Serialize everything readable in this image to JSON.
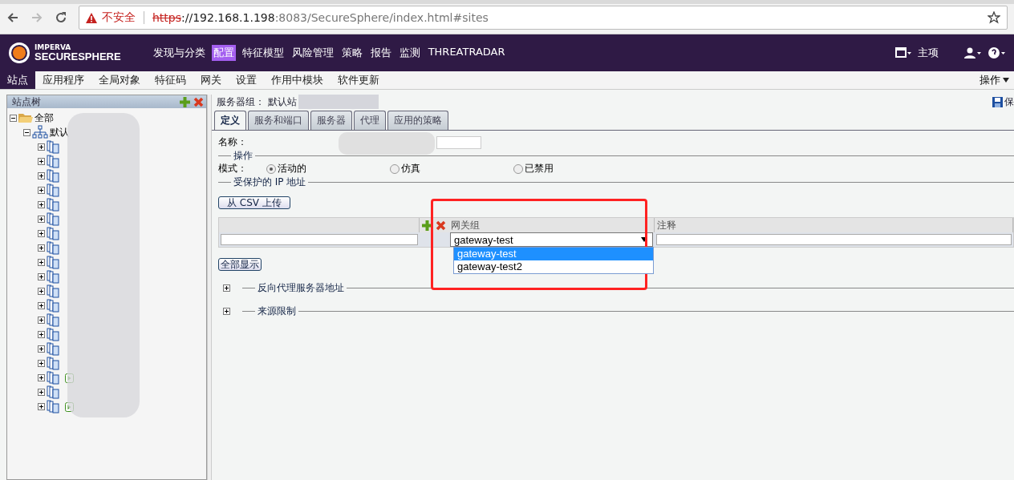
{
  "browser": {
    "security_label": "不安全",
    "url_scheme": "https",
    "url_host": "://192.168.1.198",
    "url_path": ":8083/SecureSphere/index.html#sites"
  },
  "header": {
    "brand_top": "IMPERVA",
    "brand_bottom": "SECURESPHERE",
    "nav": [
      {
        "label": "发现与分类",
        "selected": false
      },
      {
        "label": "配置",
        "selected": true
      },
      {
        "label": "特征模型",
        "selected": false
      },
      {
        "label": "风险管理",
        "selected": false
      },
      {
        "label": "策略",
        "selected": false
      },
      {
        "label": "报告",
        "selected": false
      },
      {
        "label": "监测",
        "selected": false
      },
      {
        "label": "THREATRADAR",
        "selected": false
      }
    ],
    "home_label": "主项"
  },
  "subnav": {
    "tabs": [
      {
        "label": "站点",
        "selected": true
      },
      {
        "label": "应用程序",
        "selected": false
      },
      {
        "label": "全局对象",
        "selected": false
      },
      {
        "label": "特征码",
        "selected": false
      },
      {
        "label": "网关",
        "selected": false
      },
      {
        "label": "设置",
        "selected": false
      },
      {
        "label": "作用中模块",
        "selected": false
      },
      {
        "label": "软件更新",
        "selected": false
      }
    ],
    "actions_label": "操作"
  },
  "sidebar": {
    "title": "站点树",
    "tree": [
      {
        "label": "全部",
        "expanded": true,
        "children": [
          {
            "label": "默认",
            "expanded": true,
            "children": [
              {
                "expanded": false,
                "running": false
              },
              {
                "expanded": false,
                "running": false
              },
              {
                "expanded": false,
                "running": false
              },
              {
                "expanded": false,
                "running": false
              },
              {
                "expanded": false,
                "running": false
              },
              {
                "expanded": false,
                "running": false
              },
              {
                "expanded": false,
                "running": false
              },
              {
                "expanded": false,
                "running": false
              },
              {
                "expanded": false,
                "running": false
              },
              {
                "expanded": false,
                "running": false
              },
              {
                "expanded": false,
                "running": false
              },
              {
                "expanded": false,
                "running": false
              },
              {
                "expanded": false,
                "running": false
              },
              {
                "expanded": false,
                "running": false
              },
              {
                "expanded": false,
                "running": false
              },
              {
                "expanded": false,
                "running": false
              },
              {
                "expanded": false,
                "running": true
              },
              {
                "expanded": false,
                "running": false
              },
              {
                "expanded": false,
                "running": true
              }
            ]
          }
        ]
      }
    ]
  },
  "content": {
    "breadcrumb": "服务器组： 默认站",
    "save_label": "保",
    "tabs": [
      {
        "label": "定义",
        "selected": true
      },
      {
        "label": "服务和端口",
        "selected": false
      },
      {
        "label": "服务器",
        "selected": false
      },
      {
        "label": "代理",
        "selected": false
      },
      {
        "label": "应用的策略",
        "selected": false
      }
    ],
    "name_label": "名称：",
    "operation_legend": "操作",
    "mode_label": "模式：",
    "modes": [
      {
        "label": "活动的",
        "selected": true
      },
      {
        "label": "仿真",
        "selected": false
      },
      {
        "label": "已禁用",
        "selected": false
      }
    ],
    "ip_legend": "受保护的 IP 地址",
    "upload_button": "从 CSV 上传",
    "table": {
      "columns": [
        "网关组",
        "注释"
      ],
      "gateway_value": "gateway-test",
      "options": [
        {
          "label": "gateway-test",
          "selected": true
        },
        {
          "label": "gateway-test2",
          "selected": false
        }
      ]
    },
    "show_all_button": "全部显示",
    "sections": [
      {
        "label": "反向代理服务器地址",
        "expanded": false
      },
      {
        "label": "来源限制",
        "expanded": false
      }
    ]
  }
}
